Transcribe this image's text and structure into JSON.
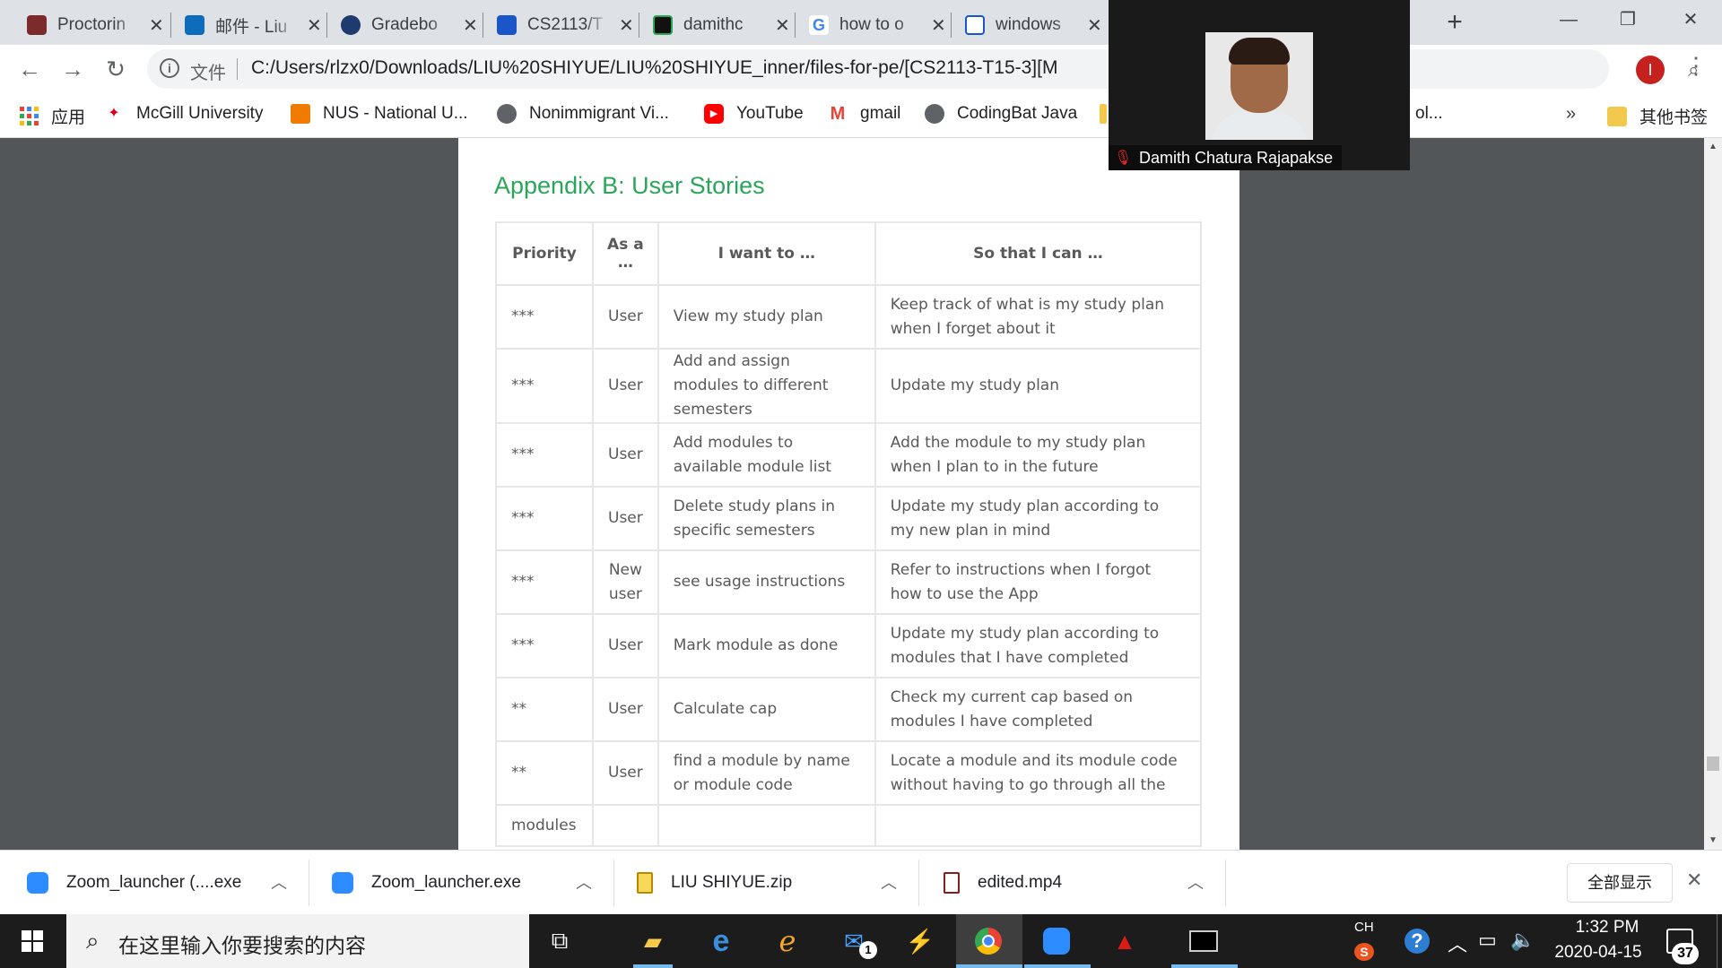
{
  "browser": {
    "tabs": [
      {
        "label": "Proctorin",
        "icon": "university-crest-icon"
      },
      {
        "label": "邮件 - Liu",
        "icon": "outlook-icon"
      },
      {
        "label": "Gradebo",
        "icon": "gradebook-icon"
      },
      {
        "label": "CS2113/T",
        "icon": "graduation-cap-icon"
      },
      {
        "label": "damithc",
        "icon": "bars-icon"
      },
      {
        "label": "how to o",
        "icon": "google-icon"
      },
      {
        "label": "windows",
        "icon": "document-arrow-icon"
      }
    ],
    "new_tab": "+",
    "window_controls": {
      "minimize": "—",
      "restore": "❐",
      "close": "✕"
    },
    "address": {
      "scheme_label": "文件",
      "url": "C:/Users/rlzx0/Downloads/LIU%20SHIYUE/LIU%20SHIYUE_inner/files-for-pe/[CS2113-T15-3][M"
    },
    "profile_initial": "I",
    "bookmarks": [
      {
        "label": "应用",
        "icon": "apps-grid-icon"
      },
      {
        "label": "McGill University",
        "icon": "mcgill-icon"
      },
      {
        "label": "NUS - National U...",
        "icon": "nus-crest-icon"
      },
      {
        "label": "Nonimmigrant Vi...",
        "icon": "globe-icon"
      },
      {
        "label": "YouTube",
        "icon": "youtube-icon"
      },
      {
        "label": "gmail",
        "icon": "gmail-icon"
      },
      {
        "label": "CodingBat Java",
        "icon": "globe-icon"
      },
      {
        "label": "ol...",
        "icon": "folder-icon"
      }
    ],
    "bookmarks_more": "»",
    "other_bookmarks": "其他书签"
  },
  "document": {
    "heading": "Appendix B: User Stories",
    "table": {
      "headers": [
        "Priority",
        "As a …",
        "I want to …",
        "So that I can …"
      ],
      "rows": [
        [
          "***",
          "User",
          "View my study plan",
          "Keep track of what is my study plan when I forget about it"
        ],
        [
          "***",
          "User",
          "Add and assign modules to different semesters",
          "Update my study plan"
        ],
        [
          "***",
          "User",
          "Add modules to available module list",
          "Add the module to my study plan when I plan to in the future"
        ],
        [
          "***",
          "User",
          "Delete study plans in specific semesters",
          "Update my study plan according to my new plan in mind"
        ],
        [
          "***",
          "New user",
          "see usage instructions",
          "Refer to instructions when I forgot how to use the App"
        ],
        [
          "***",
          "User",
          "Mark module as done",
          "Update my study plan according to modules that I have completed"
        ],
        [
          "**",
          "User",
          "Calculate cap",
          "Check my current cap based on modules I have completed"
        ],
        [
          "**",
          "User",
          "find a module by name or module code",
          "Locate a module and its module code without having to go through all the"
        ],
        [
          "modules",
          "",
          "",
          ""
        ]
      ]
    }
  },
  "zoom_overlay": {
    "participant_name": "Damith Chatura Rajapakse"
  },
  "downloads": {
    "items": [
      {
        "name": "Zoom_launcher (....exe",
        "icon": "zoom-icon"
      },
      {
        "name": "Zoom_launcher.exe",
        "icon": "zoom-icon"
      },
      {
        "name": "LIU SHIYUE.zip",
        "icon": "zip-file-icon"
      },
      {
        "name": "edited.mp4",
        "icon": "video-file-icon"
      }
    ],
    "show_all": "全部显示",
    "close": "✕"
  },
  "taskbar": {
    "search_placeholder": "在这里输入你要搜索的内容",
    "mail_badge": "1",
    "tray_lang": "CH",
    "time": "1:32 PM",
    "date": "2020-04-15",
    "notification_count": "37"
  },
  "colors": {
    "heading_green": "#2aa55a",
    "viewer_bg": "#525659",
    "taskbar_bg": "#1c1c1c",
    "accent_blue": "#76b9ed"
  }
}
